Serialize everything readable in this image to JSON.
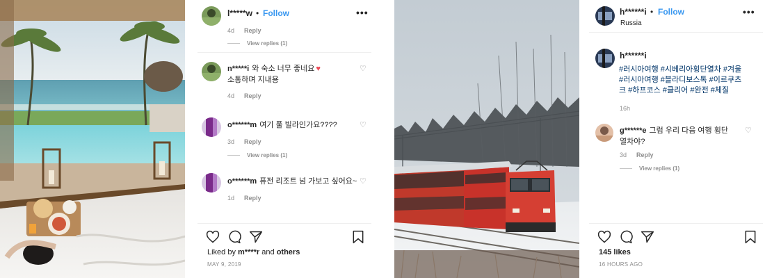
{
  "left_post": {
    "header": {
      "username": "l*****w",
      "dot": "•",
      "follow": "Follow",
      "more": "•••"
    },
    "comments": [
      {
        "meta_time": "4d",
        "reply": "Reply",
        "view_replies": "View replies (1)"
      },
      {
        "username": "n*****i",
        "text": "와 숙소 너무 좋네요",
        "text2": "소통하며 지내용",
        "meta_time": "4d",
        "reply": "Reply"
      },
      {
        "username": "o******m",
        "text": "여기 풀 빌라인가요????",
        "meta_time": "3d",
        "reply": "Reply",
        "view_replies": "View replies (1)"
      },
      {
        "username": "o******m",
        "text": "퓨전 리조트 넘 가보고 싶어요~",
        "meta_time": "1d",
        "reply": "Reply"
      }
    ],
    "likes_prefix": "Liked by ",
    "likes_user": "m****r",
    "likes_suffix": " and ",
    "likes_others": "others",
    "date": "MAY 9, 2019"
  },
  "right_post": {
    "header": {
      "username": "h******i",
      "dot": "•",
      "follow": "Follow",
      "more": "•••",
      "location": "Russia"
    },
    "caption_username": "h******i",
    "hashtags": "#러시아여행 #시베리아횡단열차 #겨울 #러시아여행 #블라디보스톡 #이르쿠츠크 #하프코스 #클리어 #완전 #체질",
    "caption_time": "16h",
    "comment": {
      "username": "g******e",
      "text": "그럼 우리 다음 여행 횡단 열차야?",
      "meta_time": "3d",
      "reply": "Reply",
      "view_replies": "View replies (1)"
    },
    "likes": "145 likes",
    "date": "16 HOURS AGO"
  },
  "icons": [
    "heart-icon",
    "comment-icon",
    "share-icon",
    "bookmark-icon"
  ],
  "colors": {
    "follow": "#3897f0",
    "hashtag": "#003569",
    "text": "#262626",
    "muted": "#8e8e8e",
    "heart_red": "#ed4956"
  }
}
